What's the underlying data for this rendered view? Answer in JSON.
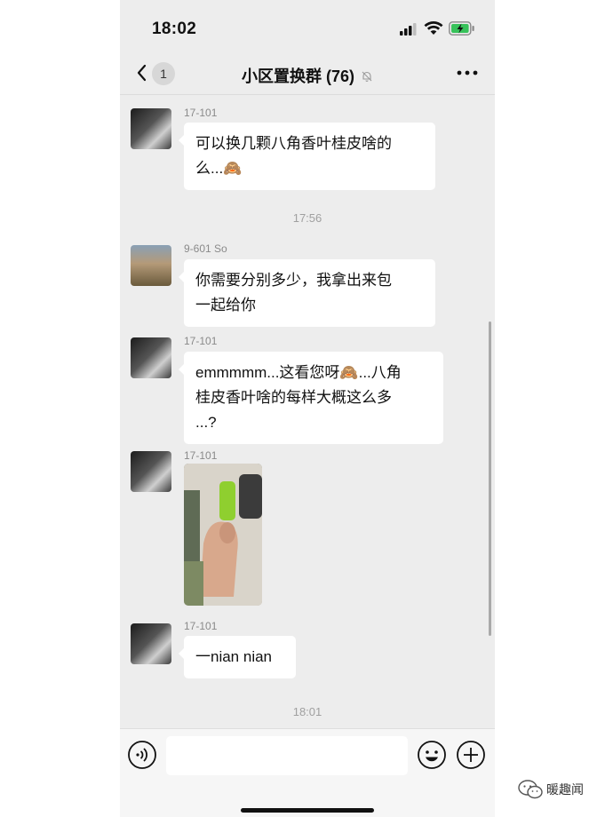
{
  "status_bar": {
    "time": "18:02"
  },
  "header": {
    "back_badge": "1",
    "title": "小区置换群 (76)"
  },
  "messages": [
    {
      "sender": "17-101",
      "text": "可以换几颗八角香叶桂皮啥的\n么...🙈"
    },
    {
      "timestamp": "17:56"
    },
    {
      "sender": "9-601 So",
      "text": "你需要分别多少，我拿出来包\n一起给你"
    },
    {
      "sender": "17-101",
      "text": "emmmmm...这看您呀🙈...八角\n桂皮香叶啥的每样大概这么多\n...?"
    },
    {
      "sender": "17-101",
      "image": "photo of hand holding spices"
    },
    {
      "sender": "17-101",
      "text": "一nian nian"
    },
    {
      "timestamp": "18:01"
    }
  ],
  "input_bar": {
    "voice_icon": "voice-icon",
    "emoji_icon": "emoji-icon",
    "plus_icon": "plus-icon"
  },
  "watermark": {
    "text": "暖趣闻"
  },
  "colors": {
    "chat_bg": "#ededed",
    "bubble_bg": "#ffffff",
    "meta_text": "#8a8a8a"
  }
}
